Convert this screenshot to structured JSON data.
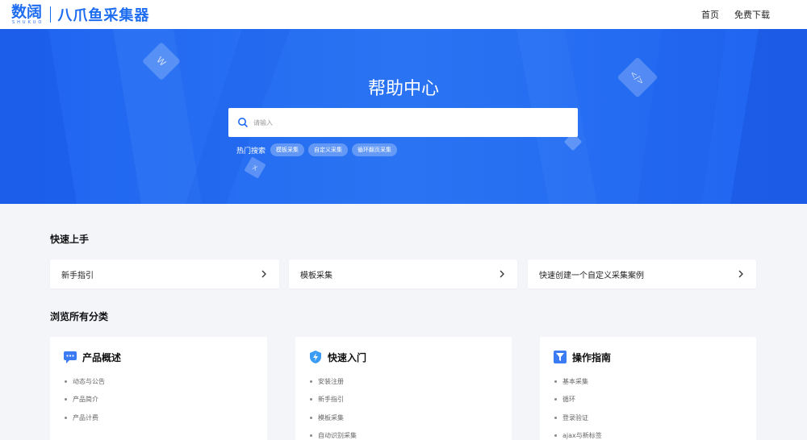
{
  "header": {
    "logo_cn": "数阔",
    "logo_en": "SHUKUO",
    "product": "八爪鱼采集器",
    "nav": [
      "首页",
      "免费下载"
    ]
  },
  "hero": {
    "title": "帮助中心",
    "search_placeholder": "请输入",
    "hot_label": "热门搜索",
    "hot_tags": [
      "模板采集",
      "自定义采集",
      "循环翻页采集"
    ]
  },
  "quick_start": {
    "title": "快速上手",
    "items": [
      "新手指引",
      "模板采集",
      "快速创建一个自定义采集案例"
    ]
  },
  "browse": {
    "title": "浏览所有分类",
    "categories": [
      {
        "title": "产品概述",
        "icon": "chat-bubble-icon",
        "items": [
          "动态与公告",
          "产品简介",
          "产品计费"
        ]
      },
      {
        "title": "快速入门",
        "icon": "shield-bolt-icon",
        "items": [
          "安装注册",
          "新手指引",
          "模板采集",
          "自动识别采集"
        ]
      },
      {
        "title": "操作指南",
        "icon": "funnel-box-icon",
        "items": [
          "基本采集",
          "循环",
          "登录验证",
          "ajax与新标签"
        ]
      }
    ]
  },
  "colors": {
    "brand": "#1e6cf0",
    "hero": "#2a74f3",
    "page_bg": "#f3f5f9"
  }
}
